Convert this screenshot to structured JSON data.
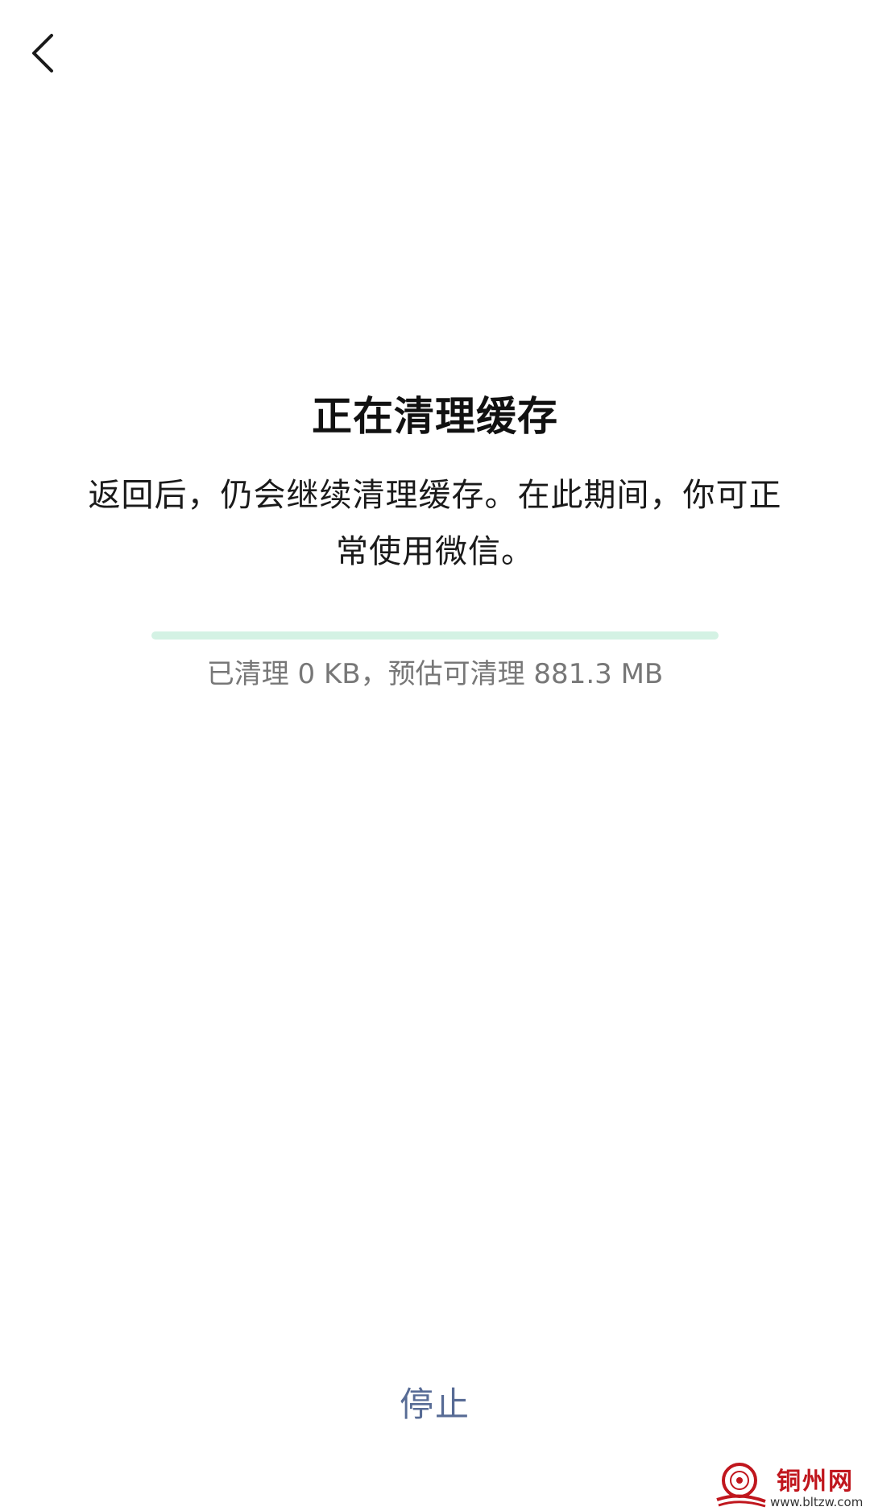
{
  "header": {
    "back_icon": "chevron-left-icon"
  },
  "main": {
    "title": "正在清理缓存",
    "description": "返回后，仍会继续清理缓存。在此期间，你可正常使用微信。",
    "progress_fraction": 0,
    "status_text": "已清理 0 KB，预估可清理 881.3 MB"
  },
  "footer": {
    "stop_label": "停止"
  },
  "watermark": {
    "name": "铜州网",
    "url": "www.bltzw.com"
  },
  "colors": {
    "progress_track": "#d4f2e4",
    "progress_fill": "#07c160",
    "link_blue": "#576b95",
    "watermark_red": "#c0161d"
  }
}
